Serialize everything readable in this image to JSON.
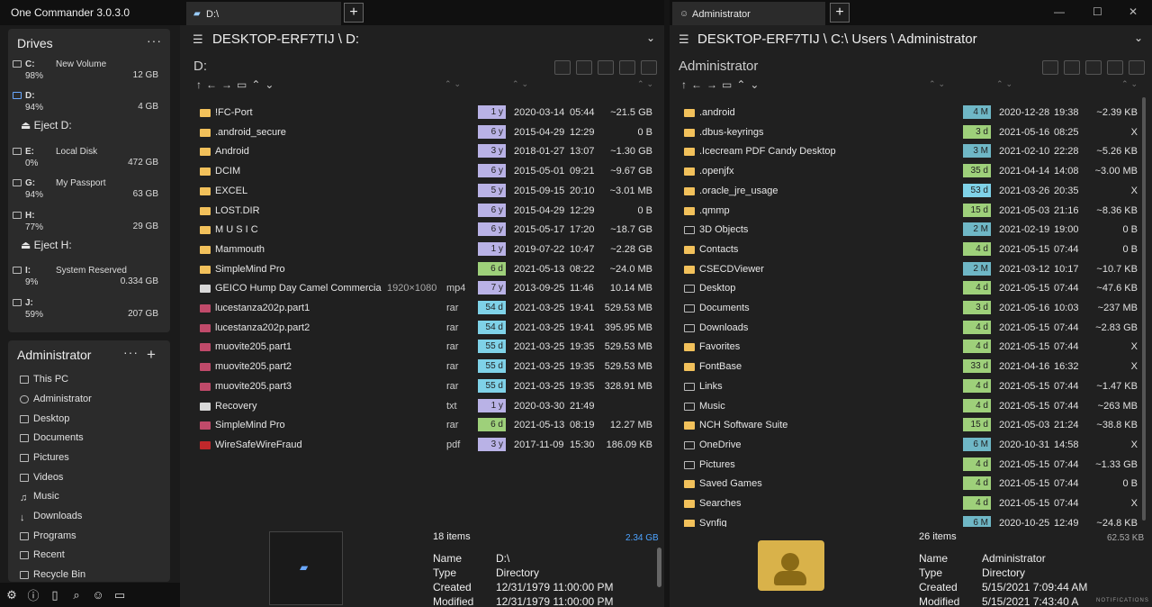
{
  "app_title": "One Commander 3.0.3.0",
  "drives_panel": {
    "title": "Drives",
    "more_label": "···",
    "drives": [
      {
        "letter": "C:",
        "name": "New Volume",
        "pct": "98%",
        "size": "12 GB"
      },
      {
        "letter": "D:",
        "name": "",
        "pct": "94%",
        "size": "4 GB"
      },
      {
        "letter": "E:",
        "name": "Local Disk",
        "pct": "0%",
        "size": "472 GB"
      },
      {
        "letter": "G:",
        "name": "My Passport",
        "pct": "94%",
        "size": "63 GB"
      },
      {
        "letter": "H:",
        "name": "",
        "pct": "77%",
        "size": "29 GB"
      },
      {
        "letter": "I:",
        "name": "System Reserved",
        "pct": "9%",
        "size": "0.334 GB"
      },
      {
        "letter": "J:",
        "name": "",
        "pct": "59%",
        "size": "207 GB"
      }
    ],
    "eject_d": "Eject D:",
    "eject_h": "Eject H:"
  },
  "places_panel": {
    "title": "Administrator",
    "more_label": "···",
    "add_label": "+",
    "items": [
      "This PC",
      "Administrator",
      "Desktop",
      "Documents",
      "Pictures",
      "Videos",
      "Music",
      "Downloads",
      "Programs",
      "Recent",
      "Recycle Bin"
    ]
  },
  "bottom_icons": [
    "gear-icon",
    "info-icon",
    "phone-icon",
    "search-icon",
    "users-icon",
    "window-icon"
  ],
  "left_pane": {
    "tab_label": "D:\\",
    "new_tab": "+",
    "path": "DESKTOP-ERF7TIJ \\ D:",
    "current": "D:",
    "files": [
      {
        "name": "!FC-Port",
        "type": "folder",
        "dim": "",
        "ext": "",
        "age": "1 y",
        "date": "2020-03-14",
        "time": "05:44",
        "size": "~21.5 GB"
      },
      {
        "name": ".android_secure",
        "type": "folder",
        "dim": "",
        "ext": "",
        "age": "6 y",
        "date": "2015-04-29",
        "time": "12:29",
        "size": "0 B"
      },
      {
        "name": "Android",
        "type": "folder",
        "dim": "",
        "ext": "",
        "age": "3 y",
        "date": "2018-01-27",
        "time": "13:07",
        "size": "~1.30 GB"
      },
      {
        "name": "DCIM",
        "type": "folder",
        "dim": "",
        "ext": "",
        "age": "6 y",
        "date": "2015-05-01",
        "time": "09:21",
        "size": "~9.67 GB"
      },
      {
        "name": "EXCEL",
        "type": "folder",
        "dim": "",
        "ext": "",
        "age": "5 y",
        "date": "2015-09-15",
        "time": "20:10",
        "size": "~3.01 MB"
      },
      {
        "name": "LOST.DIR",
        "type": "folder",
        "dim": "",
        "ext": "",
        "age": "6 y",
        "date": "2015-04-29",
        "time": "12:29",
        "size": "0 B"
      },
      {
        "name": "M U S I C",
        "type": "folder",
        "dim": "",
        "ext": "",
        "age": "6 y",
        "date": "2015-05-17",
        "time": "17:20",
        "size": "~18.7 GB"
      },
      {
        "name": "Mammouth",
        "type": "folder",
        "dim": "",
        "ext": "",
        "age": "1 y",
        "date": "2019-07-22",
        "time": "10:47",
        "size": "~2.28 GB"
      },
      {
        "name": "SimpleMind Pro",
        "type": "folder",
        "dim": "",
        "ext": "",
        "age": "6 d",
        "date": "2021-05-13",
        "time": "08:22",
        "size": "~24.0 MB"
      },
      {
        "name": "GEICO Hump Day Camel Commercial...",
        "type": "doc",
        "dim": "1920×1080",
        "ext": "mp4",
        "age": "7 y",
        "date": "2013-09-25",
        "time": "11:46",
        "size": "10.14 MB"
      },
      {
        "name": "lucestanza202p.part1",
        "type": "rar",
        "dim": "",
        "ext": "rar",
        "age": "54 d",
        "date": "2021-03-25",
        "time": "19:41",
        "size": "529.53 MB"
      },
      {
        "name": "lucestanza202p.part2",
        "type": "rar",
        "dim": "",
        "ext": "rar",
        "age": "54 d",
        "date": "2021-03-25",
        "time": "19:41",
        "size": "395.95 MB"
      },
      {
        "name": "muovite205.part1",
        "type": "rar",
        "dim": "",
        "ext": "rar",
        "age": "55 d",
        "date": "2021-03-25",
        "time": "19:35",
        "size": "529.53 MB"
      },
      {
        "name": "muovite205.part2",
        "type": "rar",
        "dim": "",
        "ext": "rar",
        "age": "55 d",
        "date": "2021-03-25",
        "time": "19:35",
        "size": "529.53 MB"
      },
      {
        "name": "muovite205.part3",
        "type": "rar",
        "dim": "",
        "ext": "rar",
        "age": "55 d",
        "date": "2021-03-25",
        "time": "19:35",
        "size": "328.91 MB"
      },
      {
        "name": "Recovery",
        "type": "doc",
        "dim": "",
        "ext": "txt",
        "age": "1 y",
        "date": "2020-03-30",
        "time": "21:49",
        "size": ""
      },
      {
        "name": "SimpleMind Pro",
        "type": "rar",
        "dim": "",
        "ext": "rar",
        "age": "6 d",
        "date": "2021-05-13",
        "time": "08:19",
        "size": "12.27 MB"
      },
      {
        "name": "WireSafeWireFraud",
        "type": "pdf",
        "dim": "",
        "ext": "pdf",
        "age": "3 y",
        "date": "2017-11-09",
        "time": "15:30",
        "size": "186.09 KB"
      }
    ],
    "count": "18 items",
    "total": "2.34 GB",
    "details": {
      "name_k": "Name",
      "name_v": "D:\\",
      "type_k": "Type",
      "type_v": "Directory",
      "created_k": "Created",
      "created_v": "12/31/1979 11:00:00 PM",
      "modified_k": "Modified",
      "modified_v": "12/31/1979 11:00:00 PM"
    }
  },
  "right_pane": {
    "tab_label": "Administrator",
    "new_tab": "+",
    "path": "DESKTOP-ERF7TIJ \\ C:\\ Users \\ Administrator",
    "current": "Administrator",
    "files": [
      {
        "name": ".android",
        "type": "folder",
        "age": "4 M",
        "date": "2020-12-28",
        "time": "19:38",
        "size": "~2.39 KB"
      },
      {
        "name": ".dbus-keyrings",
        "type": "folder",
        "age": "3 d",
        "date": "2021-05-16",
        "time": "08:25",
        "size": "X"
      },
      {
        "name": ".Icecream PDF Candy Desktop",
        "type": "folder",
        "age": "3 M",
        "date": "2021-02-10",
        "time": "22:28",
        "size": "~5.26 KB"
      },
      {
        "name": ".openjfx",
        "type": "folder",
        "age": "35 d",
        "date": "2021-04-14",
        "time": "14:08",
        "size": "~3.00 MB"
      },
      {
        "name": ".oracle_jre_usage",
        "type": "folder",
        "age": "53 d",
        "date": "2021-03-26",
        "time": "20:35",
        "size": "X"
      },
      {
        "name": ".qmmp",
        "type": "folder",
        "age": "15 d",
        "date": "2021-05-03",
        "time": "21:16",
        "size": "~8.36 KB"
      },
      {
        "name": "3D Objects",
        "type": "sys",
        "age": "2 M",
        "date": "2021-02-19",
        "time": "19:00",
        "size": "0 B"
      },
      {
        "name": "Contacts",
        "type": "folder",
        "age": "4 d",
        "date": "2021-05-15",
        "time": "07:44",
        "size": "0 B"
      },
      {
        "name": "CSECDViewer",
        "type": "folder",
        "age": "2 M",
        "date": "2021-03-12",
        "time": "10:17",
        "size": "~10.7 KB"
      },
      {
        "name": "Desktop",
        "type": "sys",
        "age": "4 d",
        "date": "2021-05-15",
        "time": "07:44",
        "size": "~47.6 KB"
      },
      {
        "name": "Documents",
        "type": "sys",
        "age": "3 d",
        "date": "2021-05-16",
        "time": "10:03",
        "size": "~237 MB"
      },
      {
        "name": "Downloads",
        "type": "sys",
        "age": "4 d",
        "date": "2021-05-15",
        "time": "07:44",
        "size": "~2.83 GB"
      },
      {
        "name": "Favorites",
        "type": "folder",
        "age": "4 d",
        "date": "2021-05-15",
        "time": "07:44",
        "size": "X"
      },
      {
        "name": "FontBase",
        "type": "folder",
        "age": "33 d",
        "date": "2021-04-16",
        "time": "16:32",
        "size": "X"
      },
      {
        "name": "Links",
        "type": "sys",
        "age": "4 d",
        "date": "2021-05-15",
        "time": "07:44",
        "size": "~1.47 KB"
      },
      {
        "name": "Music",
        "type": "sys",
        "age": "4 d",
        "date": "2021-05-15",
        "time": "07:44",
        "size": "~263 MB"
      },
      {
        "name": "NCH Software Suite",
        "type": "folder",
        "age": "15 d",
        "date": "2021-05-03",
        "time": "21:24",
        "size": "~38.8 KB"
      },
      {
        "name": "OneDrive",
        "type": "sys",
        "age": "6 M",
        "date": "2020-10-31",
        "time": "14:58",
        "size": "X"
      },
      {
        "name": "Pictures",
        "type": "sys",
        "age": "4 d",
        "date": "2021-05-15",
        "time": "07:44",
        "size": "~1.33 GB"
      },
      {
        "name": "Saved Games",
        "type": "folder",
        "age": "4 d",
        "date": "2021-05-15",
        "time": "07:44",
        "size": "0 B"
      },
      {
        "name": "Searches",
        "type": "folder",
        "age": "4 d",
        "date": "2021-05-15",
        "time": "07:44",
        "size": "X"
      },
      {
        "name": "Synfig",
        "type": "folder",
        "age": "6 M",
        "date": "2020-10-25",
        "time": "12:49",
        "size": "~24.8 KB"
      }
    ],
    "count": "26 items",
    "total": "62.53 KB",
    "details": {
      "name_k": "Name",
      "name_v": "Administrator",
      "type_k": "Type",
      "type_v": "Directory",
      "created_k": "Created",
      "created_v": "5/15/2021 7:09:44 AM",
      "modified_k": "Modified",
      "modified_v": "5/15/2021 7:43:40 A"
    },
    "notifications": "NOTIFICATIONS"
  },
  "colors": {
    "age_year": "#b9b2e6",
    "age_day": "#9ed07a",
    "age_54": "#7fd2e8",
    "age_month": "#6fb7c6",
    "accent_blue": "#4da3ff"
  }
}
